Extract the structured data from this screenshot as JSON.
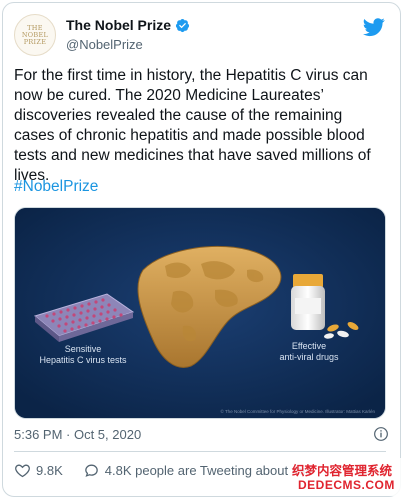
{
  "account": {
    "display_name": "The Nobel Prize",
    "handle": "@NobelPrize",
    "avatar_text": [
      "THE",
      "NOBEL",
      "PRIZE"
    ],
    "verified": true
  },
  "tweet": {
    "text": "For the first time in history, the Hepatitis C virus can now be cured. The 2020 Medicine Laureates’ discoveries revealed the cause of the remaining cases of chronic hepatitis and made possible blood tests and new medicines that have saved millions of lives.",
    "hashtag": "#NobelPrize",
    "timestamp": "5:36 PM · Oct 5, 2020"
  },
  "media": {
    "label_tests_line1": "Sensitive",
    "label_tests_line2": "Hepatitis C virus tests",
    "label_drugs_line1": "Effective",
    "label_drugs_line2": "anti-viral drugs",
    "credit": "© The Nobel Committee for Physiology or Medicine. Illustrator: Mattias Karlén"
  },
  "actions": {
    "likes": "9.8K",
    "tweeting_about": "4.8K people are Tweeting about this"
  },
  "watermark": {
    "top": "织梦内容管理系统",
    "bottom": "DEDECMS.COM"
  },
  "colors": {
    "link": "#1b95e0",
    "verified": "#1d9bf0",
    "media_background": "#0d2a52",
    "liver": "#c9974a",
    "watermark": "#e0242f"
  }
}
